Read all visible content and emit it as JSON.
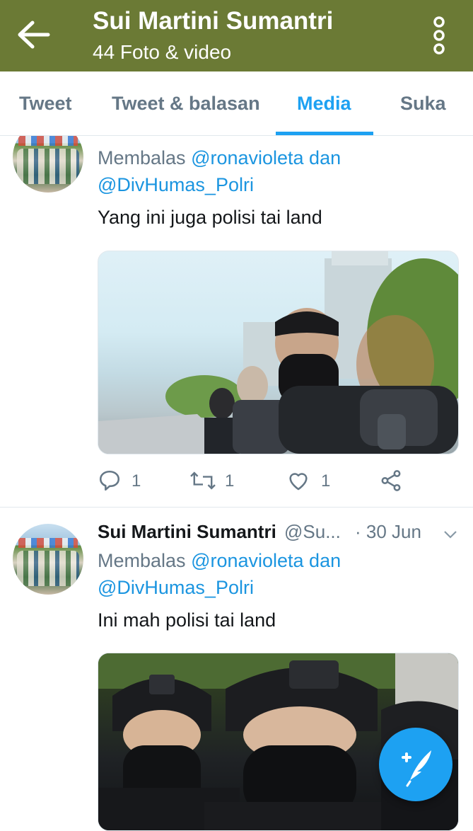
{
  "header": {
    "title": "Sui Martini Sumantri",
    "subtitle": "44 Foto & video",
    "bg_color": "#6b7a35"
  },
  "tabs": [
    {
      "label": "Tweet",
      "active": false
    },
    {
      "label": "Tweet & balasan",
      "active": false
    },
    {
      "label": "Media",
      "active": true
    },
    {
      "label": "Suka",
      "active": false
    }
  ],
  "accent_color": "#1da1f2",
  "tweets": [
    {
      "reply_prefix": "Membalas",
      "reply_mentions_line1": "@ronavioleta dan",
      "reply_mentions_line2": "@DivHumas_Polri",
      "text": "Yang ini juga polisi tai land",
      "image": "photo-police-officers-masked-outdoor",
      "actions": {
        "reply_count": "1",
        "retweet_count": "1",
        "like_count": "1"
      }
    },
    {
      "name": "Sui Martini Sumantri",
      "handle": "@Su...",
      "date": "· 30 Jun",
      "reply_prefix": "Membalas",
      "reply_mentions_line1": "@ronavioleta dan",
      "reply_mentions_line2": "@DivHumas_Polri",
      "text": "Ini mah polisi tai land",
      "image": "photo-police-officers-helmets-masks"
    }
  ],
  "icons": {
    "back": "arrow-left-icon",
    "menu": "more-vertical-icon",
    "reply": "reply-icon",
    "retweet": "retweet-icon",
    "like": "heart-icon",
    "share": "share-icon",
    "compose": "compose-tweet-icon"
  }
}
